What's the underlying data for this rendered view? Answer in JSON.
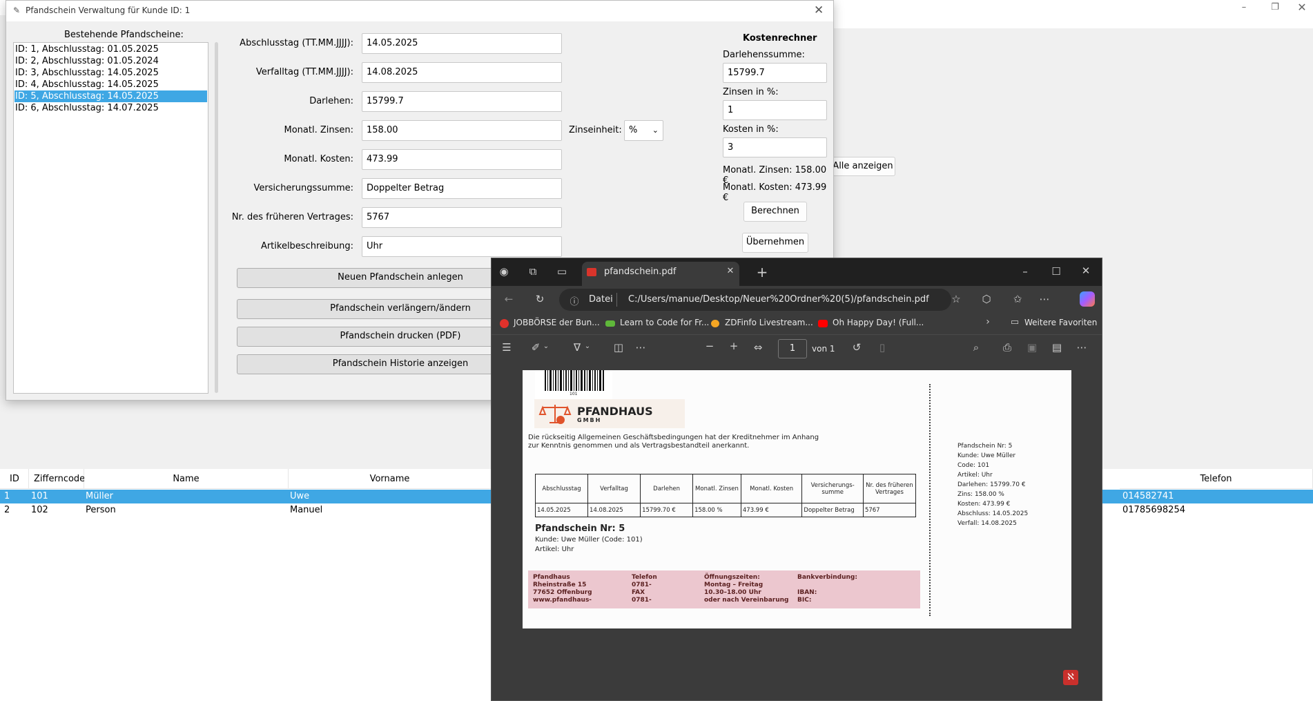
{
  "dialog": {
    "title": "Pfandschein Verwaltung für Kunde ID: 1",
    "list_title": "Bestehende Pfandscheine:",
    "list_items": [
      "ID: 1, Abschlusstag: 01.05.2025",
      "ID: 2, Abschlusstag: 01.05.2024",
      "ID: 3, Abschlusstag: 14.05.2025",
      "ID: 4, Abschlusstag: 14.05.2025",
      "ID: 5, Abschlusstag: 14.05.2025",
      "ID: 6, Abschlusstag: 14.07.2025"
    ],
    "fields": [
      {
        "label": "Abschlusstag (TT.MM.JJJJ):",
        "value": "14.05.2025"
      },
      {
        "label": "Verfalltag (TT.MM.JJJJ):",
        "value": "14.08.2025"
      },
      {
        "label": "Darlehen:",
        "value": "15799.7"
      },
      {
        "label": "Monatl. Zinsen:",
        "value": "158.00"
      },
      {
        "label": "Monatl. Kosten:",
        "value": "473.99"
      },
      {
        "label": "Versicherungssumme:",
        "value": "Doppelter Betrag"
      },
      {
        "label": "Nr. des früheren Vertrages:",
        "value": "5767"
      },
      {
        "label": "Artikelbeschreibung:",
        "value": "Uhr"
      }
    ],
    "zinseinheit_label": "Zinseinheit:",
    "zinseinheit_value": "%",
    "buttons": {
      "new": "Neuen Pfandschein anlegen",
      "extend": "Pfandschein verlängern/ändern",
      "print": "Pfandschein drucken (PDF)",
      "history": "Pfandschein Historie anzeigen"
    },
    "calc": {
      "title": "Kostenrechner",
      "loan_label": "Darlehenssumme:",
      "loan_value": "15799.7",
      "interest_label": "Zinsen in %:",
      "interest_value": "1",
      "cost_label": "Kosten in %:",
      "cost_value": "3",
      "result_interest": "Monatl. Zinsen: 158.00 €",
      "result_cost": "Monatl. Kosten: 473.99 €",
      "calc_button": "Berechnen",
      "apply_button": "Übernehmen"
    }
  },
  "background": {
    "show_all_button": "Alle anzeigen",
    "table_headers": [
      "ID",
      "Zifferncode",
      "Name",
      "Vorname",
      "Telefon"
    ],
    "rows": [
      {
        "id": "1",
        "code": "101",
        "name": "Müller",
        "vorname": "Uwe",
        "telefon": "014582741"
      },
      {
        "id": "2",
        "code": "102",
        "name": "Person",
        "vorname": "Manuel",
        "telefon": "01785698254"
      }
    ]
  },
  "browser": {
    "tab_title": "pfandschein.pdf",
    "address_prefix": "Datei",
    "address": "C:/Users/manue/Desktop/Neuer%20Ordner%20(5)/pfandschein.pdf",
    "favorites": [
      "JOBBÖRSE der Bun...",
      "Learn to Code for Fr...",
      "ZDFinfo Livestream...",
      "Oh Happy Day! (Full..."
    ],
    "favorites_more": "Weitere Favoriten",
    "page_number": "1",
    "page_total": "von 1"
  },
  "pdf": {
    "barcode_number": "101",
    "company": "PFANDHAUS",
    "company_sub": "GMBH",
    "agb_line1": "Die rückseitig Allgemeinen Geschäftsbedingungen hat der Kreditnehmer im Anhang",
    "agb_line2": "zur Kenntnis genommen und als Vertragsbestandteil anerkannt.",
    "table_headers": [
      "Abschlusstag",
      "Verfalltag",
      "Darlehen",
      "Monatl. Zinsen",
      "Monatl. Kosten",
      "Versicherungs- summe",
      "Nr. des früheren Vertrages"
    ],
    "table_values": [
      "14.05.2025",
      "14.08.2025",
      "15799.70 €",
      "158.00 %",
      "473.99 €",
      "Doppelter Betrag",
      "5767"
    ],
    "heading": "Pfandschein Nr: 5",
    "customer_line": "Kunde: Uwe Müller  (Code: 101)",
    "article_line": "Artikel: Uhr",
    "footer": {
      "col1": [
        "Pfandhaus",
        "Rheinstraße 15",
        "77652 Offenburg",
        "www.pfandhaus-"
      ],
      "col2": [
        "Telefon",
        "0781-",
        "FAX",
        "0781-"
      ],
      "col3": [
        "Öffnungszeiten:",
        "Montag – Freitag",
        "10.30–18.00 Uhr",
        "oder nach Vereinbarung"
      ],
      "col4": [
        "Bankverbindung:",
        "",
        "IBAN:",
        "BIC:"
      ]
    },
    "stub": [
      "Pfandschein Nr: 5",
      "Kunde: Uwe Müller",
      "Code: 101",
      "Artikel: Uhr",
      "Darlehen: 15799.70 €",
      "Zins: 158.00 %",
      "Kosten: 473.99 €",
      "Abschluss: 14.05.2025",
      "Verfall: 14.08.2025"
    ]
  }
}
